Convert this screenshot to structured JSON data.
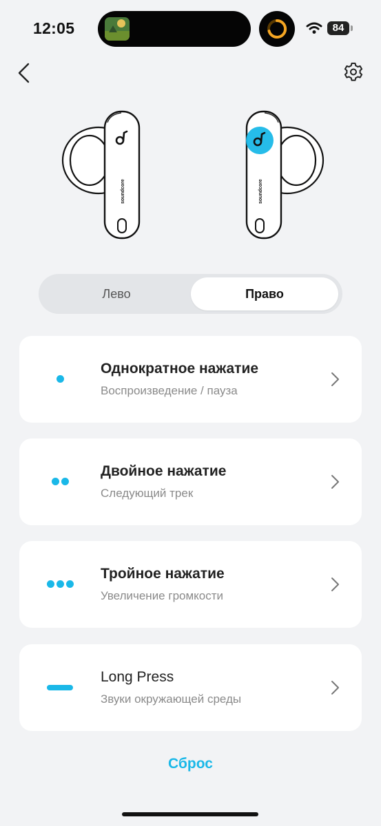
{
  "status_bar": {
    "time": "12:05",
    "battery": "84",
    "icons": [
      "now-playing-artwork-icon",
      "activity-ring-icon",
      "wifi-icon",
      "battery-icon"
    ]
  },
  "nav": {
    "back_icon": "chevron-left-icon",
    "settings_icon": "gear-icon"
  },
  "earbuds": {
    "brand_text": "soundcore",
    "selected_side": "right",
    "highlight_color": "#1ab8e8"
  },
  "tabs": {
    "left_label": "Лево",
    "right_label": "Право",
    "selected": "right"
  },
  "controls": [
    {
      "title": "Однократное нажатие",
      "action": "Воспроизведение / пауза",
      "icon": "single-dot-icon"
    },
    {
      "title": "Двойное нажатие",
      "action": "Следующий трек",
      "icon": "double-dot-icon"
    },
    {
      "title": "Тройное нажатие",
      "action": "Увеличение громкости",
      "icon": "triple-dot-icon"
    },
    {
      "title": "Long Press",
      "action": "Звуки окружающей среды",
      "icon": "dash-icon"
    }
  ],
  "reset_label": "Сброс",
  "colors": {
    "accent": "#1ab8e8",
    "background": "#f2f3f5",
    "card": "#ffffff"
  }
}
